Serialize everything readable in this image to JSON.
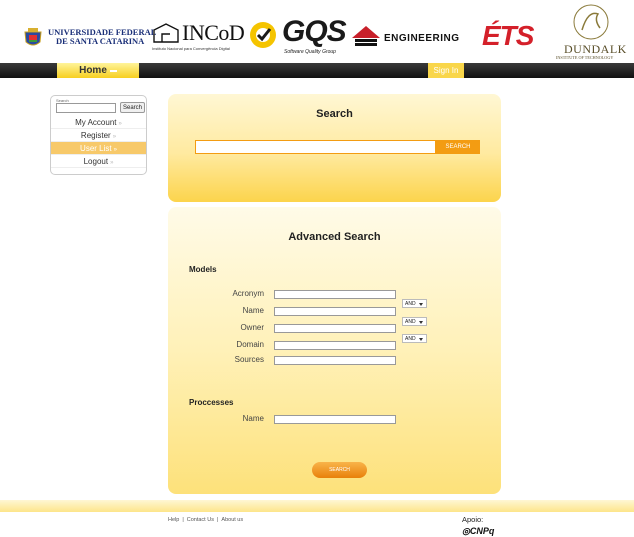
{
  "logos": {
    "ufsc_line1": "UNIVERSIDADE FEDERAL",
    "ufsc_line2": "DE SANTA CATARINA",
    "incod_name": "INCoD",
    "incod_sub": "Instituto Nacional para Convergência Digital",
    "gqs_name": "GQS",
    "gqs_sub": "Software Quality Group",
    "eng_name": "ENGINEERING",
    "ets_name": "ÉTS",
    "dundalk_name": "DUNDALK",
    "dundalk_sub": "INSTITUTE OF TECHNOLOGY"
  },
  "nav": {
    "home_label": "Home",
    "signin_label": "Sign In"
  },
  "sidebar": {
    "search_label": "Search",
    "search_button": "Search",
    "items": [
      {
        "label": "My Account"
      },
      {
        "label": "Register"
      },
      {
        "label": "User List"
      },
      {
        "label": "Logout"
      }
    ]
  },
  "search_panel": {
    "title": "Search",
    "button": "SEARCH"
  },
  "advanced": {
    "title": "Advanced Search",
    "models_label": "Models",
    "fields": [
      "Acronym",
      "Name",
      "Owner",
      "Domain",
      "Sources"
    ],
    "and_options": [
      "AND",
      "AND",
      "AND"
    ],
    "processes_label": "Proccesses",
    "process_field": "Name",
    "button": "SEARCH"
  },
  "footer": {
    "help": "Help",
    "contact": "Contact Us",
    "about": "About us",
    "apoio": "Apoio:",
    "cnpq": "CNPq"
  },
  "colors": {
    "accent": "#f39c12",
    "panel_yellow": "#fcd44c",
    "nav_dark": "#1a1a1a"
  }
}
